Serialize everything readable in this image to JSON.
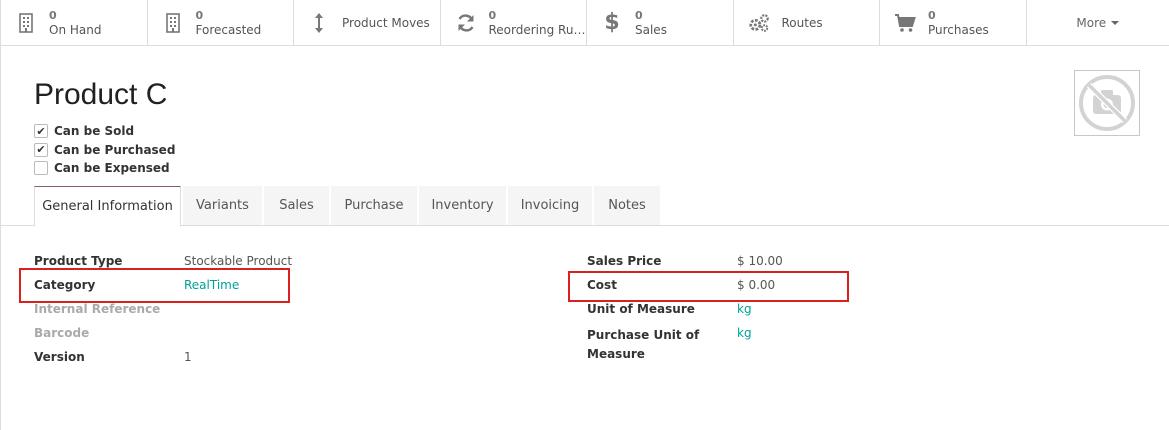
{
  "button_bar": {
    "on_hand": {
      "count": "0",
      "label": "On Hand"
    },
    "forecasted": {
      "count": "0",
      "label": "Forecasted"
    },
    "product_moves": {
      "label": "Product Moves"
    },
    "reordering": {
      "count": "0",
      "label": "Reordering Rul..."
    },
    "sales": {
      "count": "0",
      "label": "Sales"
    },
    "routes": {
      "label": "Routes"
    },
    "purchases": {
      "count": "0",
      "label": "Purchases"
    },
    "more": {
      "label": "More"
    }
  },
  "product": {
    "name": "Product C",
    "options": [
      {
        "label": "Can be Sold",
        "checked": true
      },
      {
        "label": "Can be Purchased",
        "checked": true
      },
      {
        "label": "Can be Expensed",
        "checked": false
      }
    ]
  },
  "tabs": [
    "General Information",
    "Variants",
    "Sales",
    "Purchase",
    "Inventory",
    "Invoicing",
    "Notes"
  ],
  "left_fields": {
    "product_type": {
      "label": "Product Type",
      "value": "Stockable Product"
    },
    "category": {
      "label": "Category",
      "value": "RealTime"
    },
    "internal_reference": {
      "label": "Internal Reference",
      "value": ""
    },
    "barcode": {
      "label": "Barcode",
      "value": ""
    },
    "version": {
      "label": "Version",
      "value": "1"
    }
  },
  "right_fields": {
    "sales_price": {
      "label": "Sales Price",
      "value": "$ 10.00"
    },
    "cost": {
      "label": "Cost",
      "value": "$ 0.00"
    },
    "uom": {
      "label": "Unit of Measure",
      "value": "kg"
    },
    "purchase_uom": {
      "label_line1": "Purchase Unit of",
      "label_line2": "Measure",
      "value": "kg"
    }
  },
  "colors": {
    "accent": "#875a7b",
    "link": "#00a09d",
    "highlight": "#dc1f1f"
  }
}
